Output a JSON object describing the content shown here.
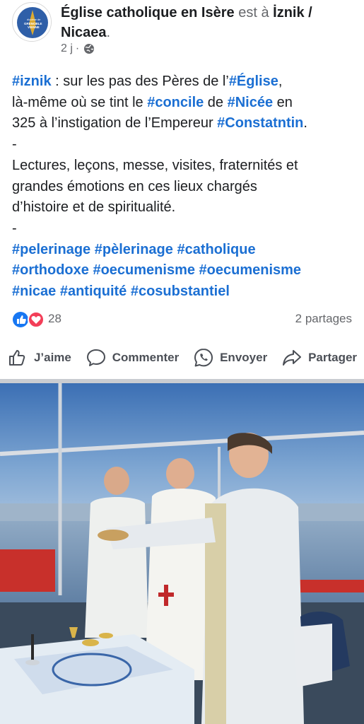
{
  "post": {
    "author": "Église catholique en Isère",
    "connector": " est à ",
    "location_bold": "İznik /",
    "location_line2": "Nicaea",
    "location_suffix": ".",
    "time": "2 j",
    "time_separator": "·",
    "privacy_icon": "globe-icon",
    "avatar_text": [
      "diocèse de",
      "GRENOBLE",
      "VIENNE"
    ]
  },
  "body": {
    "p1": {
      "t1": "#iznik",
      "t2": " : sur les pas des Pères de l’",
      "t3": "#Église",
      "t4": ",",
      "t5": "là-même où se tint le ",
      "t6": "#concile",
      "t7": " de ",
      "t8": "#Nicée",
      "t9": " en",
      "t10": "325 à l’instigation de l’Empereur ",
      "t11": "#Constatntin",
      "t12": "."
    },
    "sep1": "-",
    "p2_line1": "Lectures, leçons, messe, visites, fraternités et",
    "p2_line2": "grandes émotions en ces lieux chargés",
    "p2_line3": "d’histoire et de spiritualité.",
    "sep2": "-",
    "hashtags_line1": [
      "#pelerinage",
      "#pèlerinage",
      "#catholique"
    ],
    "hashtags_line2": [
      "#orthodoxe",
      "#oecumenisme",
      "#oecumenisme"
    ],
    "hashtags_line3": [
      "#nicae",
      "#antiquité",
      "#cosubstantiel"
    ]
  },
  "reactions": {
    "count": "28",
    "shares": "2 partages",
    "icons": [
      "like-reaction-icon",
      "love-reaction-icon"
    ]
  },
  "actions": {
    "like": "J’aime",
    "comment": "Commenter",
    "send": "Envoyer",
    "share": "Partager"
  },
  "colors": {
    "hashtag": "#1b6fd3",
    "muted_text": "#65676b",
    "like_blue": "#1877f2",
    "love_red": "#f33e58"
  }
}
